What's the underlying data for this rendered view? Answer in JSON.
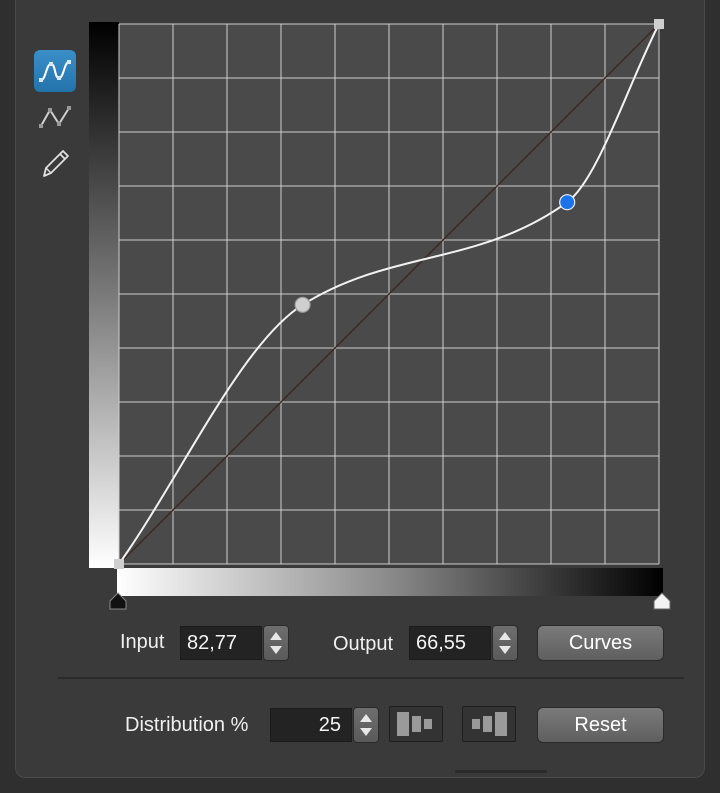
{
  "toolbar": {
    "tools": [
      {
        "name": "smooth-curve-tool",
        "icon": "smooth-curve-icon",
        "active": true
      },
      {
        "name": "linear-curve-tool",
        "icon": "linear-curve-icon",
        "active": false
      },
      {
        "name": "pencil-tool",
        "icon": "pencil-icon",
        "active": false
      }
    ]
  },
  "curve": {
    "control_points": [
      {
        "input": 0,
        "output": 0
      },
      {
        "input": 34,
        "output": 48
      },
      {
        "input": 83,
        "output": 67
      },
      {
        "input": 100,
        "output": 100
      }
    ],
    "selected_point_index": 2,
    "grid_divisions": 10
  },
  "colors": {
    "selected_point": "#1a73e8",
    "point": "#cfcfcf",
    "curve": "#f2f2f2",
    "diagonal": "#3a2a24",
    "grid_bg": "#4a4a4a",
    "grid_line": "#cfcfcf"
  },
  "controls": {
    "input_label": "Input",
    "input_value": "82,77",
    "output_label": "Output",
    "output_value": "66,55",
    "curves_button": "Curves",
    "distribution_label": "Distribution %",
    "distribution_value": "25",
    "reset_button": "Reset"
  }
}
